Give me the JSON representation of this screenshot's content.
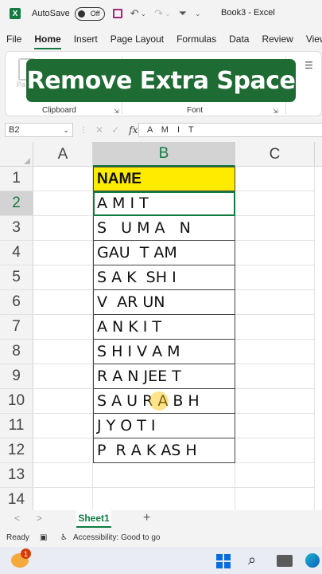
{
  "titlebar": {
    "app_icon": "X",
    "autosave_label": "AutoSave",
    "toggle_state": "Off",
    "title": "Book3 - Excel"
  },
  "ribbon_tabs": [
    "File",
    "Home",
    "Insert",
    "Page Layout",
    "Formulas",
    "Data",
    "Review",
    "View"
  ],
  "ribbon": {
    "group_clipboard": "Clipboard",
    "group_font": "Font",
    "paste_ghost": "Pa"
  },
  "overlay_banner": "Remove Extra Space",
  "formula_bar": {
    "name_box": "B2",
    "fx": "fx",
    "value": "A M I T"
  },
  "columns": [
    "A",
    "B",
    "C"
  ],
  "rows": [
    {
      "num": "1",
      "b": "NAME"
    },
    {
      "num": "2",
      "b": "A M I T"
    },
    {
      "num": "3",
      "b": "S   U M A   N"
    },
    {
      "num": "4",
      "b": "GAU  T AM"
    },
    {
      "num": "5",
      "b": "S A K  SH I"
    },
    {
      "num": "6",
      "b": "V  AR UN"
    },
    {
      "num": "7",
      "b": "A N K I T"
    },
    {
      "num": "8",
      "b": "S H I V A M"
    },
    {
      "num": "9",
      "b": "R A N JEE T"
    },
    {
      "num": "10",
      "b": "S A U R A B H"
    },
    {
      "num": "11",
      "b": "J Y O T I"
    },
    {
      "num": "12",
      "b": "P  R A K AS H"
    },
    {
      "num": "13",
      "b": ""
    },
    {
      "num": "14",
      "b": ""
    }
  ],
  "sheet_tabs": {
    "active": "Sheet1",
    "add": "+",
    "prev": "<",
    "next": ">"
  },
  "statusbar": {
    "ready": "Ready",
    "accessibility": "Accessibility: Good to go"
  },
  "taskbar": {
    "badge_count": "1",
    "search_icon": "⚲"
  }
}
